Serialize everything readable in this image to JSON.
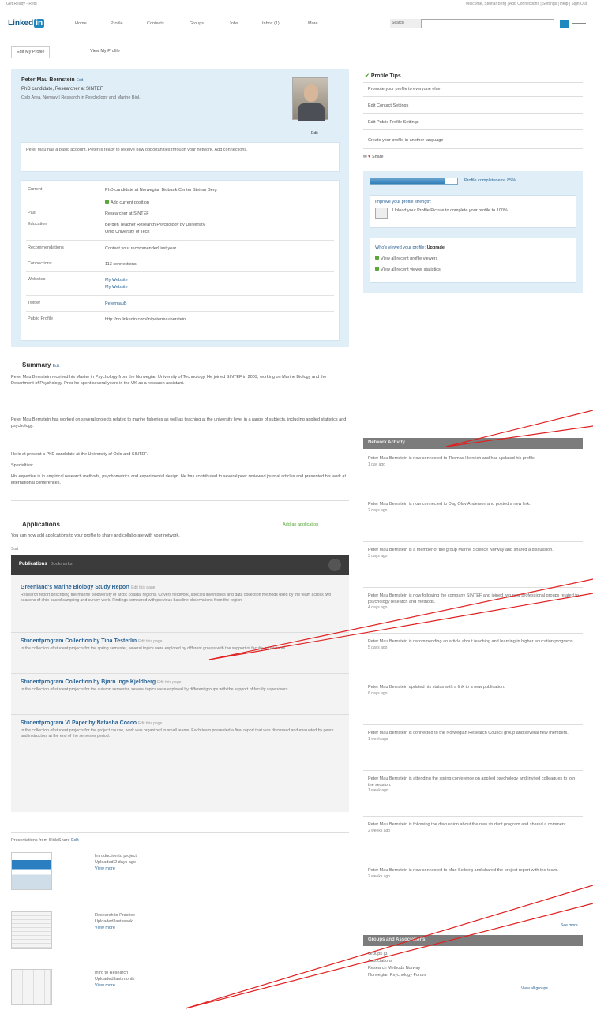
{
  "topbar": {
    "left_text": "Get Ready - Redi",
    "right_text": "Welcome, Steinar Berg  |  Add Connections  |  Settings  |  Help  |  Sign Out"
  },
  "nav": {
    "logo": "Linked",
    "logo_in": "in",
    "items": [
      "Home",
      "Profile",
      "Contacts",
      "Groups",
      "Jobs",
      "Inbox (1)",
      "More"
    ],
    "search_button": "Search",
    "search_placeholder": ""
  },
  "tabs": [
    "Edit My Profile",
    "View My Profile"
  ],
  "profile": {
    "name": "Peter Mau Bernstein",
    "edit": "Edit",
    "headline": "PhD candidate, Researcher at SINTEF",
    "location": "Oslo Area, Norway  |  Research in Psychology and Marine Biol.",
    "photo_edit": "Edit",
    "notice": "Peter Mau has a basic account. Peter is ready to receive new opportunities through your network. Add connections.",
    "details": {
      "current_label": "Current",
      "current_value": "PhD candidate at Norwegian Biobank Center Steinar Berg",
      "current_add": "Add current position",
      "past_label": "Past",
      "past_value": "Researcher at SINTEF",
      "education_label": "Education",
      "education_value_1": "Bergen Teacher Research Psychology by University",
      "education_value_2": "Ohio University of Tech",
      "recommendations_label": "Recommendations",
      "recommendations_value": "Contact your recommended last year",
      "connections_label": "Connections",
      "connections_value": "113 connections",
      "websites_label": "Websites",
      "websites_value_1": "My Website",
      "websites_value_2": "My Website",
      "twitter_label": "Twitter",
      "twitter_value": "PetermauB",
      "profile_label": "Public Profile",
      "profile_value": "http://no.linkedin.com/in/petermauberstein"
    }
  },
  "summary": {
    "title": "Summary",
    "edit": "Edit",
    "p1": "Peter Mau Bernstein received his Master in Psychology from the Norwegian University of Technology. He joined SINTEF in 2009, working on Marine Biology and the Department of Psychology. Prior he spent several years in the UK as a research assistant.",
    "p2": "Peter Mau Bernstein has worked on several projects related to marine fisheries as well as teaching at the university level in a range of subjects, including applied statistics and psychology.",
    "p3": "He is at present a PhD candidate at the University of Oslo and SINTEF.",
    "p3b": "Specialties:",
    "p4": "His expertise is in empirical research methods, psychometrics and experimental design. He has contributed to several peer reviewed journal articles and presented his work at international conferences."
  },
  "applications": {
    "title": "Applications",
    "add": "Add an application",
    "text": "You can now add applications to your profile to share and collaborate with your network."
  },
  "publications_header": {
    "label": "Publications",
    "tab": "Bookmarks",
    "sub": "Sort"
  },
  "publications": [
    {
      "title": "Greenland's Marine Biology Study Report",
      "meta": "Edit this page",
      "desc": "Research report describing the marine biodiversity of arctic coastal regions. Covers fieldwork, species inventories and data collection methods used by the team across two seasons of ship-based sampling and survey work. Findings compared with previous baseline observations from the region."
    },
    {
      "title": "Studentprogram Collection by Tina Testerlin",
      "meta": "Edit this page",
      "desc": "In the collection of student projects for the spring semester, several topics were explored by different groups with the support of faculty supervisors."
    },
    {
      "title": "Studentprogram Collection by Bjørn Inge Kjeldberg",
      "meta": "Edit this page",
      "desc": "In the collection of student projects for the autumn semester, several topics were explored by different groups with the support of faculty supervisors."
    },
    {
      "title": "Studentprogram VI Paper by Natasha Cocco",
      "meta": "Edit this page",
      "desc": "In the collection of student projects for the project course, work was organized in small teams. Each team presented a final report that was discussed and evaluated by peers and instructors at the end of the semester period."
    }
  ],
  "slideshare": {
    "title": "Presentations from SlideShare",
    "edit": "Edit",
    "items": [
      {
        "title": "Introduction to project",
        "sub": "Uploaded 2 days ago",
        "meta": "View more"
      },
      {
        "title": "Research to Practice",
        "sub": "Uploaded last week",
        "meta": "View more"
      },
      {
        "title": "Intro to Research",
        "sub": "Uploaded last month",
        "meta": "View more"
      }
    ]
  },
  "right": {
    "edit_heading": "Profile Tips",
    "links": [
      "Promote your profile to everyone else",
      "Edit Contact Settings",
      "Edit Public Profile Settings",
      "Create your profile in another language"
    ],
    "share": "Share",
    "strength_label": "Profile completeness: 85%",
    "strength_fill": 0.85,
    "improve_head": "Improve your profile strength:",
    "improve_text": "Upload your Profile Picture to complete your profile to 100%",
    "viewers_head": "Who's viewed your profile:",
    "viewers_link": "Upgrade",
    "viewers_items": [
      "View all recent profile viewers",
      "View all recent viewer statistics"
    ]
  },
  "activity": {
    "title": "Network Activity",
    "items": [
      {
        "text": "Peter Mau Bernstein is now connected to Thomas Heinrich and has updated his profile.",
        "when": "1 day ago"
      },
      {
        "text": "Peter Mau Bernstein is now connected to Dag Olav Anderson and posted a new link.",
        "when": "2 days ago"
      },
      {
        "text": "Peter Mau Bernstein is a member of the group Marine Science Norway and shared a discussion.",
        "when": "3 days ago"
      },
      {
        "text": "Peter Mau Bernstein is now following the company SINTEF and joined two new professional groups related to psychology research and methods.",
        "when": "4 days ago"
      },
      {
        "text": "Peter Mau Bernstein is recommending an article about teaching and learning in higher education programs.",
        "when": "5 days ago"
      },
      {
        "text": "Peter Mau Bernstein updated his status with a link to a new publication.",
        "when": "6 days ago"
      },
      {
        "text": "Peter Mau Bernstein is connected to the Norwegian Research Council group and several new members.",
        "when": "1 week ago"
      },
      {
        "text": "Peter Mau Bernstein is attending the spring conference on applied psychology and invited colleagues to join the session.",
        "when": "1 week ago"
      },
      {
        "text": "Peter Mau Bernstein is following the discussion about the new student program and shared a comment.",
        "when": "2 weeks ago"
      },
      {
        "text": "Peter Mau Bernstein is now connected to Mari Solberg and shared the project report with the team.",
        "when": "2 weeks ago"
      }
    ],
    "more": "See more"
  },
  "groups": {
    "title": "Groups and Associations",
    "items": [
      "Groups (3)",
      "Associations",
      "Research Methods Norway",
      "Norwegian Psychology Forum"
    ],
    "more": "View all groups"
  }
}
